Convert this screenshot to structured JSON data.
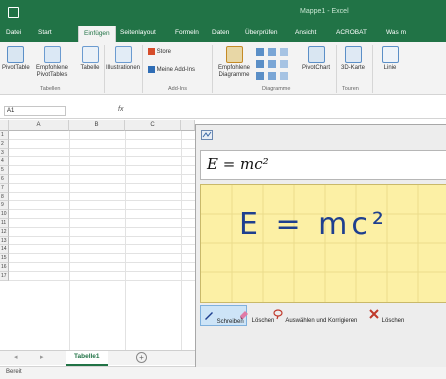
{
  "window": {
    "title": "Mappe1 - Excel"
  },
  "ribbon_tabs": [
    "Datei",
    "Start",
    "Einfügen",
    "Seitenlayout",
    "Formeln",
    "Daten",
    "Überprüfen",
    "Ansicht",
    "ACROBAT",
    "Was m"
  ],
  "active_tab": "Einfügen",
  "ribbon": {
    "pivottable": "PivotTable",
    "recommended_pivot": "Empfohlene PivotTables",
    "table": "Tabelle",
    "illustrations": "Illustrationen",
    "store": "Store",
    "my_addins": "Meine Add-Ins",
    "recommended_charts": "Empfohlene Diagramme",
    "pivotchart": "PivotChart",
    "map3d": "3D-Karte",
    "line": "Linie",
    "groups": {
      "tables": "Tabellen",
      "addins": "Add-Ins",
      "charts": "Diagramme",
      "tours": "Touren"
    }
  },
  "formula_bar": {
    "cell_ref": "A1",
    "fx": "fx"
  },
  "grid": {
    "columns": [
      "A",
      "B",
      "C"
    ],
    "rows": [
      "1",
      "2",
      "3",
      "4",
      "5",
      "6",
      "7",
      "8",
      "9",
      "10",
      "11",
      "12",
      "13",
      "14",
      "15",
      "16",
      "17"
    ]
  },
  "sheets": [
    "Tabelle1"
  ],
  "status": "Bereit",
  "math_panel": {
    "preview": "E = mc²",
    "handwriting": "E = mc²",
    "tools": [
      "Schreiben",
      "Löschen",
      "Auswählen und Korrigieren",
      "Löschen"
    ],
    "colors": {
      "writing_area": "#fcf0a5",
      "excel_green": "#217346"
    }
  }
}
